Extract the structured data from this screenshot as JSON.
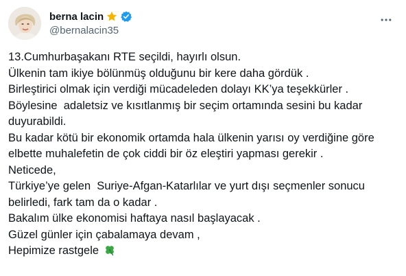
{
  "author": {
    "display_name": "berna lacin",
    "handle": "@bernalacin35",
    "avatar_icon": "profile-photo",
    "badges": [
      "star-badge-icon",
      "verified-badge-icon"
    ]
  },
  "more_icon": "ellipsis-icon",
  "tweet": {
    "lines": [
      "13.Cumhurbaşakanı RTE seçildi, hayırlı olsun.",
      "Ülkenin tam ikiye bölünmüş olduğunu bir kere daha gördük .",
      "Birleştirici olmak için verdiği mücadeleden dolayı KK’ya teşekkürler .",
      "Böylesine  adaletsiz ve kısıtlanmış bir seçim ortamında sesini bu kadar",
      "duyurabildi.",
      "Bu kadar kötü bir ekonomik ortamda hala ülkenin yarısı oy verdiğine göre",
      "elbette muhalefetin de çok ciddi bir öz eleştiri yapması gerekir .",
      "Neticede,",
      "Türkiye’ye gelen  Suriye-Afgan-Katarlılar ve yurt dışı seçmenler sonucu",
      "belirledi, fark tam da o kadar .",
      "Bakalım ülke ekonomisi haftaya nasıl başlayacak .",
      "Güzel günler için çabalamaya devam ,",
      "Hepimize rastgele"
    ],
    "last_emoji": "four-leaf-clover-icon"
  },
  "colors": {
    "verified": "#1d9bf0",
    "star": "#f4b400",
    "text": "#0f1419",
    "secondary": "#536471"
  }
}
